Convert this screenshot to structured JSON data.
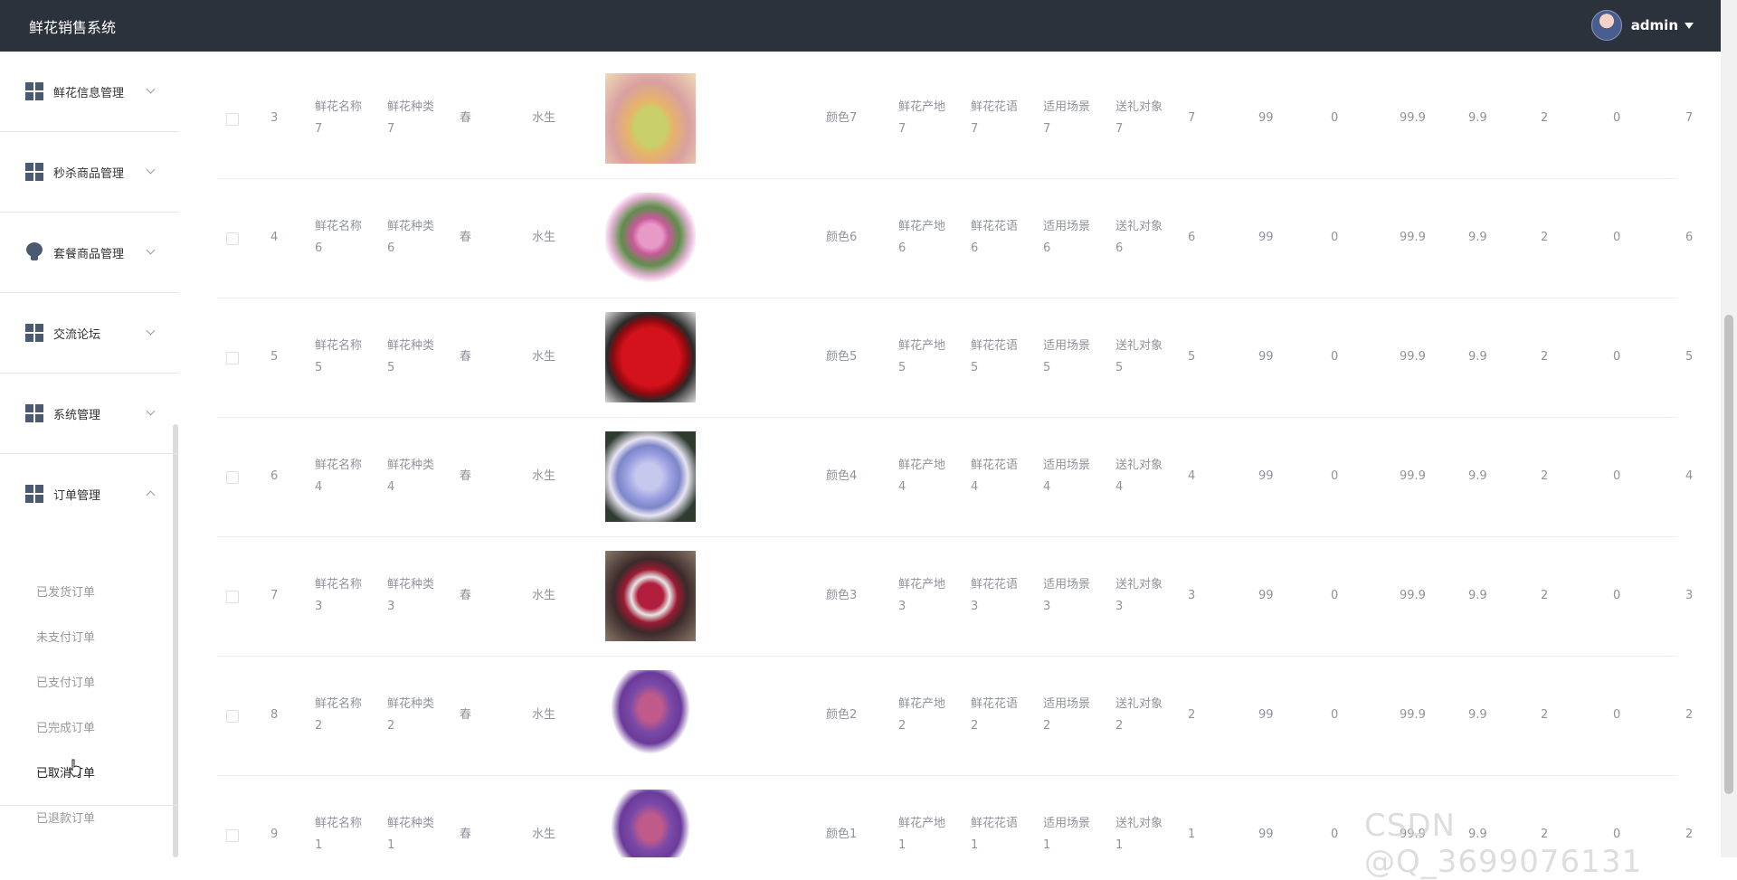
{
  "app": {
    "title": "鲜花销售系统",
    "user": "admin"
  },
  "sidebar": {
    "groups": [
      {
        "label": "鲜花信息管理",
        "icon": "grid-icon"
      },
      {
        "label": "秒杀商品管理",
        "icon": "grid-icon"
      },
      {
        "label": "套餐商品管理",
        "icon": "bulb-icon"
      },
      {
        "label": "交流论坛",
        "icon": "grid-icon"
      },
      {
        "label": "系统管理",
        "icon": "grid-icon"
      },
      {
        "label": "订单管理",
        "icon": "grid-icon",
        "expanded": true
      }
    ],
    "order_items": [
      "已发货订单",
      "未支付订单",
      "已支付订单",
      "已完成订单",
      "已取消订单",
      "已退款订单"
    ],
    "active_item": "已取消订单"
  },
  "table": {
    "rows": [
      {
        "index": "3",
        "name": [
          "鲜花名称",
          "7"
        ],
        "kind": [
          "鲜花种类",
          "7"
        ],
        "season": "春",
        "habit": "水生",
        "image": "tulip",
        "color": "颜色7",
        "origin": [
          "鲜花产地",
          "7"
        ],
        "language": [
          "鲜花花语",
          "7"
        ],
        "scene": [
          "适用场景",
          "7"
        ],
        "target": [
          "送礼对象",
          "7"
        ],
        "v1": "7",
        "v2": "99",
        "v3": "0",
        "v4": "99.9",
        "v5": "9.9",
        "v6": "2",
        "v7": "0",
        "v8": "7"
      },
      {
        "index": "4",
        "name": [
          "鲜花名称",
          "6"
        ],
        "kind": [
          "鲜花种类",
          "6"
        ],
        "season": "春",
        "habit": "水生",
        "image": "lily",
        "color": "颜色6",
        "origin": [
          "鲜花产地",
          "6"
        ],
        "language": [
          "鲜花花语",
          "6"
        ],
        "scene": [
          "适用场景",
          "6"
        ],
        "target": [
          "送礼对象",
          "6"
        ],
        "v1": "6",
        "v2": "99",
        "v3": "0",
        "v4": "99.9",
        "v5": "9.9",
        "v6": "2",
        "v7": "0",
        "v8": "6"
      },
      {
        "index": "5",
        "name": [
          "鲜花名称",
          "5"
        ],
        "kind": [
          "鲜花种类",
          "5"
        ],
        "season": "春",
        "habit": "水生",
        "image": "rose",
        "color": "颜色5",
        "origin": [
          "鲜花产地",
          "5"
        ],
        "language": [
          "鲜花花语",
          "5"
        ],
        "scene": [
          "适用场景",
          "5"
        ],
        "target": [
          "送礼对象",
          "5"
        ],
        "v1": "5",
        "v2": "99",
        "v3": "0",
        "v4": "99.9",
        "v5": "9.9",
        "v6": "2",
        "v7": "0",
        "v8": "5"
      },
      {
        "index": "6",
        "name": [
          "鲜花名称",
          "4"
        ],
        "kind": [
          "鲜花种类",
          "4"
        ],
        "season": "春",
        "habit": "水生",
        "image": "blue",
        "color": "颜色4",
        "origin": [
          "鲜花产地",
          "4"
        ],
        "language": [
          "鲜花花语",
          "4"
        ],
        "scene": [
          "适用场景",
          "4"
        ],
        "target": [
          "送礼对象",
          "4"
        ],
        "v1": "4",
        "v2": "99",
        "v3": "0",
        "v4": "99.9",
        "v5": "9.9",
        "v6": "2",
        "v7": "0",
        "v8": "4"
      },
      {
        "index": "7",
        "name": [
          "鲜花名称",
          "3"
        ],
        "kind": [
          "鲜花种类",
          "3"
        ],
        "season": "春",
        "habit": "水生",
        "image": "box",
        "color": "颜色3",
        "origin": [
          "鲜花产地",
          "3"
        ],
        "language": [
          "鲜花花语",
          "3"
        ],
        "scene": [
          "适用场景",
          "3"
        ],
        "target": [
          "送礼对象",
          "3"
        ],
        "v1": "3",
        "v2": "99",
        "v3": "0",
        "v4": "99.9",
        "v5": "9.9",
        "v6": "2",
        "v7": "0",
        "v8": "3"
      },
      {
        "index": "8",
        "name": [
          "鲜花名称",
          "2"
        ],
        "kind": [
          "鲜花种类",
          "2"
        ],
        "season": "春",
        "habit": "水生",
        "image": "bouquet",
        "color": "颜色2",
        "origin": [
          "鲜花产地",
          "2"
        ],
        "language": [
          "鲜花花语",
          "2"
        ],
        "scene": [
          "适用场景",
          "2"
        ],
        "target": [
          "送礼对象",
          "2"
        ],
        "v1": "2",
        "v2": "99",
        "v3": "0",
        "v4": "99.9",
        "v5": "9.9",
        "v6": "2",
        "v7": "0",
        "v8": "2"
      },
      {
        "index": "9",
        "name": [
          "鲜花名称",
          "1"
        ],
        "kind": [
          "鲜花种类",
          "1"
        ],
        "season": "春",
        "habit": "水生",
        "image": "bouquet",
        "color": "颜色1",
        "origin": [
          "鲜花产地",
          "1"
        ],
        "language": [
          "鲜花花语",
          "1"
        ],
        "scene": [
          "适用场景",
          "1"
        ],
        "target": [
          "送礼对象",
          "1"
        ],
        "v1": "1",
        "v2": "99",
        "v3": "0",
        "v4": "99.9",
        "v5": "9.9",
        "v6": "2",
        "v7": "0",
        "v8": "2"
      }
    ]
  },
  "watermark": "CSDN @Q_3699076131"
}
